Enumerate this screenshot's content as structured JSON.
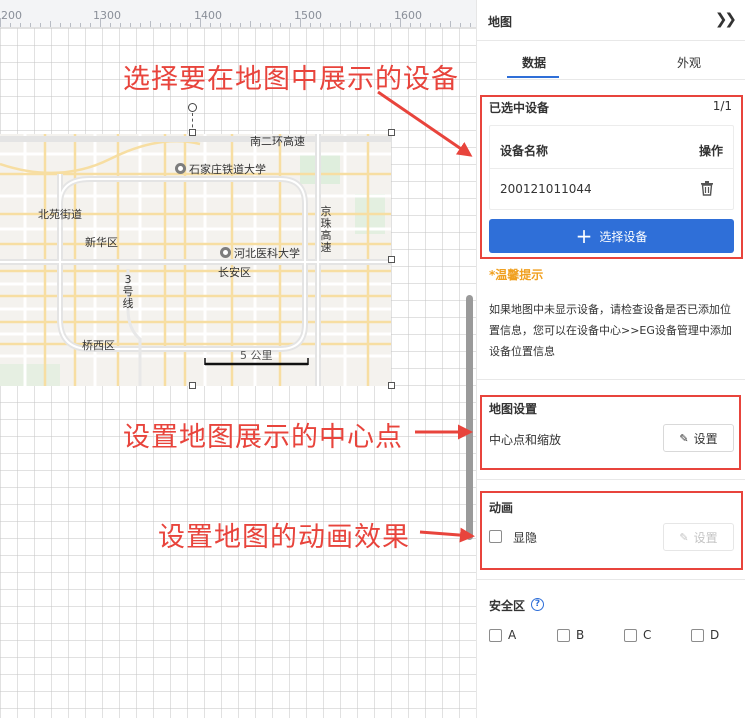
{
  "ruler": {
    "labels": [
      "200",
      "1300",
      "1400",
      "1500",
      "1600"
    ]
  },
  "map": {
    "labels": {
      "university1": "石家庄铁道大学",
      "university2": "河北医科大学",
      "district1": "新华区",
      "district2": "长安区",
      "district3": "桥西区",
      "street": "北苑街道",
      "expressway": "京珠高速",
      "top_road": "南二环高速",
      "line3": "3号线",
      "scale": "5 公里"
    }
  },
  "annotations": {
    "select_device": "选择要在地图中展示的设备",
    "center_point": "设置地图展示的中心点",
    "animation": "设置地图的动画效果"
  },
  "panel": {
    "title": "地图",
    "tabs": {
      "data": "数据",
      "appearance": "外观"
    },
    "selected_devices": {
      "title": "已选中设备",
      "count": "1/1",
      "col_name": "设备名称",
      "col_action": "操作",
      "rows": [
        {
          "name": "200121011044"
        }
      ],
      "select_button": "选择设备"
    },
    "tip": {
      "title": "*温馨提示",
      "text": "如果地图中未显示设备，请检查设备是否已添加位置信息，您可以在设备中心>>EG设备管理中添加设备位置信息"
    },
    "map_settings": {
      "title": "地图设置",
      "center_label": "中心点和缩放",
      "set_button": "设置"
    },
    "animation": {
      "title": "动画",
      "toggle_label": "显隐",
      "set_button": "设置"
    },
    "safe_zone": {
      "title": "安全区",
      "options": [
        "A",
        "B",
        "C",
        "D"
      ]
    }
  },
  "colors": {
    "accent": "#2f6fd8",
    "annotation": "#e8443c",
    "tip": "#f0a020"
  }
}
